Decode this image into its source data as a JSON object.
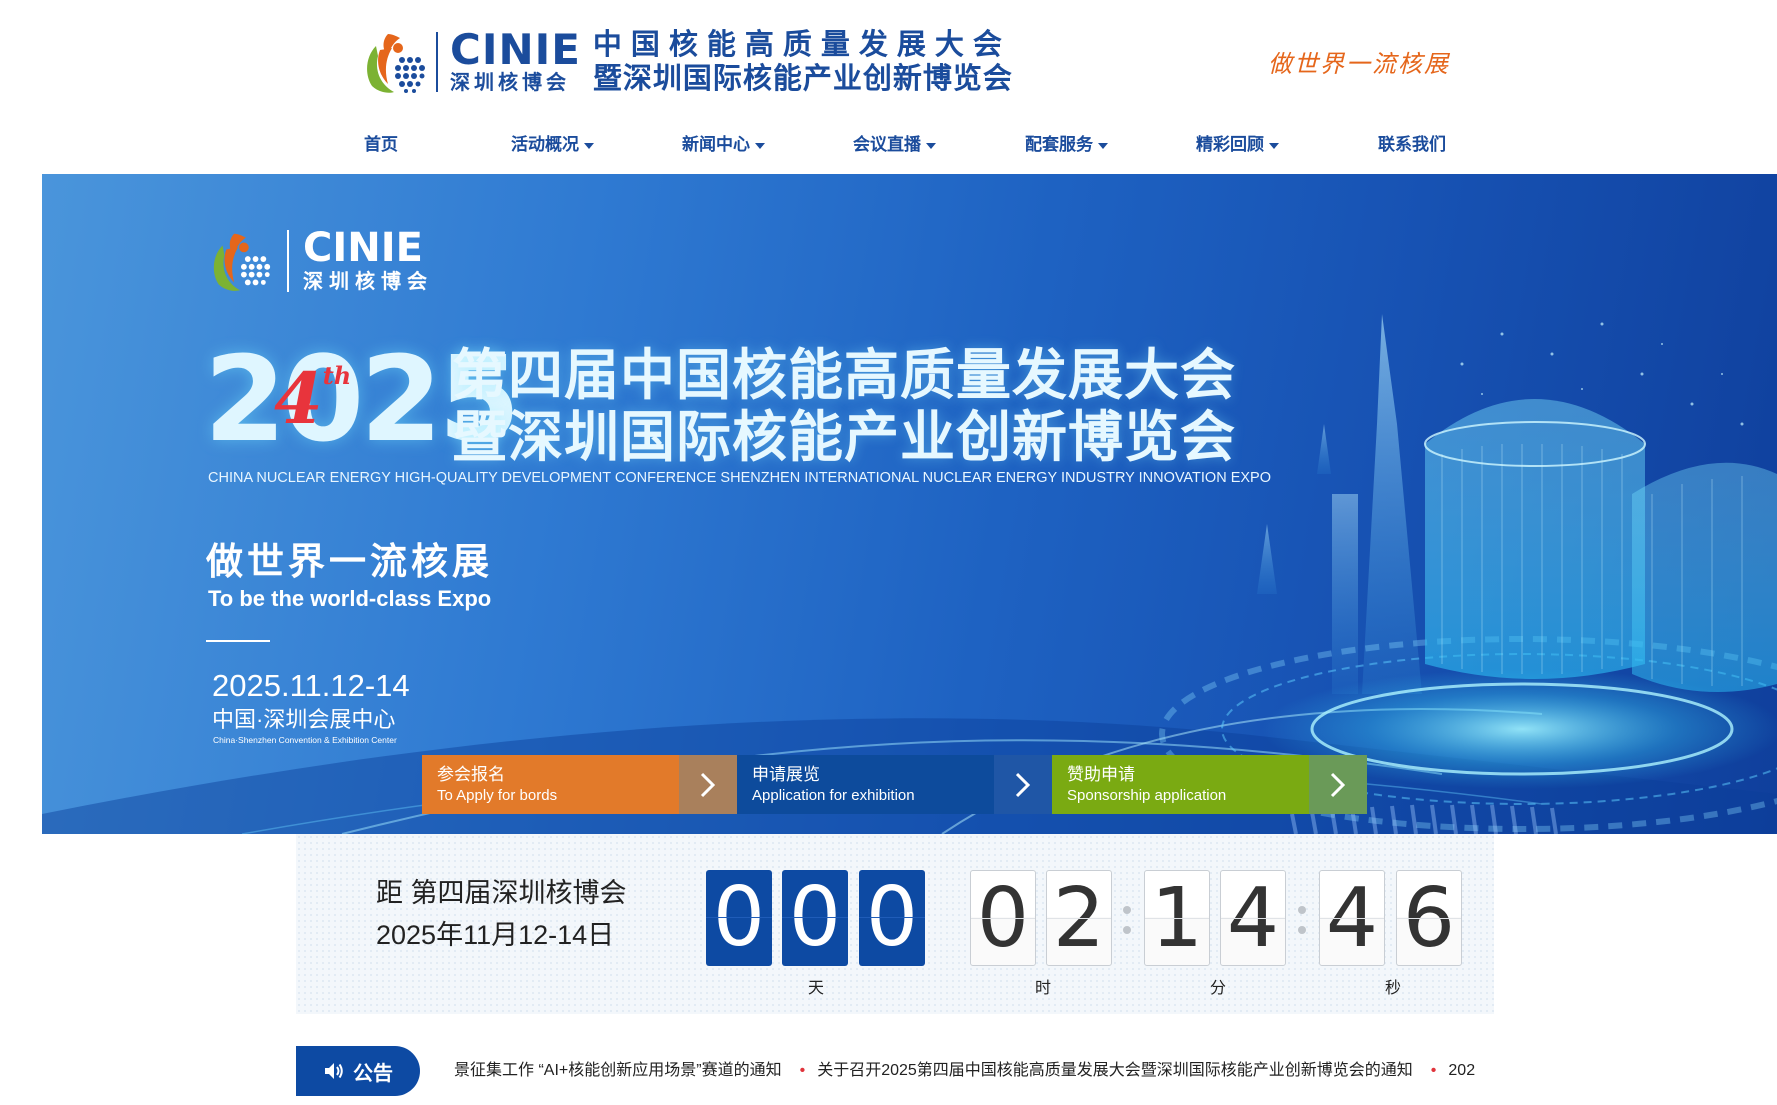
{
  "header": {
    "brand_en": "CINIE",
    "brand_cn": "深圳核博会",
    "title_line1": "中国核能高质量发展大会",
    "title_line2": "暨深圳国际核能产业创新博览会",
    "slogan": "做世界一流核展"
  },
  "nav": {
    "items": [
      {
        "label": "首页",
        "has_dropdown": false
      },
      {
        "label": "活动概况",
        "has_dropdown": true
      },
      {
        "label": "新闻中心",
        "has_dropdown": true
      },
      {
        "label": "会议直播",
        "has_dropdown": true
      },
      {
        "label": "配套服务",
        "has_dropdown": true
      },
      {
        "label": "精彩回顾",
        "has_dropdown": true
      },
      {
        "label": "联系我们",
        "has_dropdown": false
      }
    ]
  },
  "hero": {
    "brand_en": "CINIE",
    "brand_cn": "深圳核博会",
    "year": "2025",
    "edition_num": "4",
    "edition_suffix": "th",
    "title_line1": "第四届中国核能高质量发展大会",
    "title_line2": "暨深圳国际核能产业创新博览会",
    "title_en": "CHINA NUCLEAR ENERGY HIGH-QUALITY DEVELOPMENT CONFERENCE SHENZHEN INTERNATIONAL NUCLEAR ENERGY INDUSTRY INNOVATION EXPO",
    "slogan_cn": "做世界一流核展",
    "slogan_en": "To be the world-class Expo",
    "date": "2025.11.12-14",
    "venue_cn": "中国·深圳会展中心",
    "venue_en": "China·Shenzhen Convention & Exhibition Center",
    "buttons": [
      {
        "label_cn": "参会报名",
        "label_en": "To Apply for bords",
        "color": "#e27a2a"
      },
      {
        "label_cn": "申请展览",
        "label_en": "Application for exhibition",
        "color": "#0d4b9c"
      },
      {
        "label_cn": "赞助申请",
        "label_en": "Sponsorship application",
        "color": "#7aaa12"
      }
    ]
  },
  "countdown": {
    "prefix": "距",
    "event": "第四届深圳核博会",
    "date_text": "2025年11月12-14日",
    "days": [
      "0",
      "0",
      "0"
    ],
    "hours": [
      "0",
      "2"
    ],
    "minutes": [
      "1",
      "4"
    ],
    "seconds": [
      "4",
      "6"
    ],
    "unit_day": "天",
    "unit_hour": "时",
    "unit_minute": "分",
    "unit_second": "秒"
  },
  "notice": {
    "label": "公告",
    "items": [
      "景征集工作 “AI+核能创新应用场景”赛道的通知",
      "关于召开2025第四届中国核能高质量发展大会暨深圳国际核能产业创新博览会的通知",
      "202"
    ]
  },
  "colors": {
    "brand_blue": "#1b4c9c",
    "accent_orange": "#e5661b",
    "countdown_blue": "#0d4aa3"
  }
}
